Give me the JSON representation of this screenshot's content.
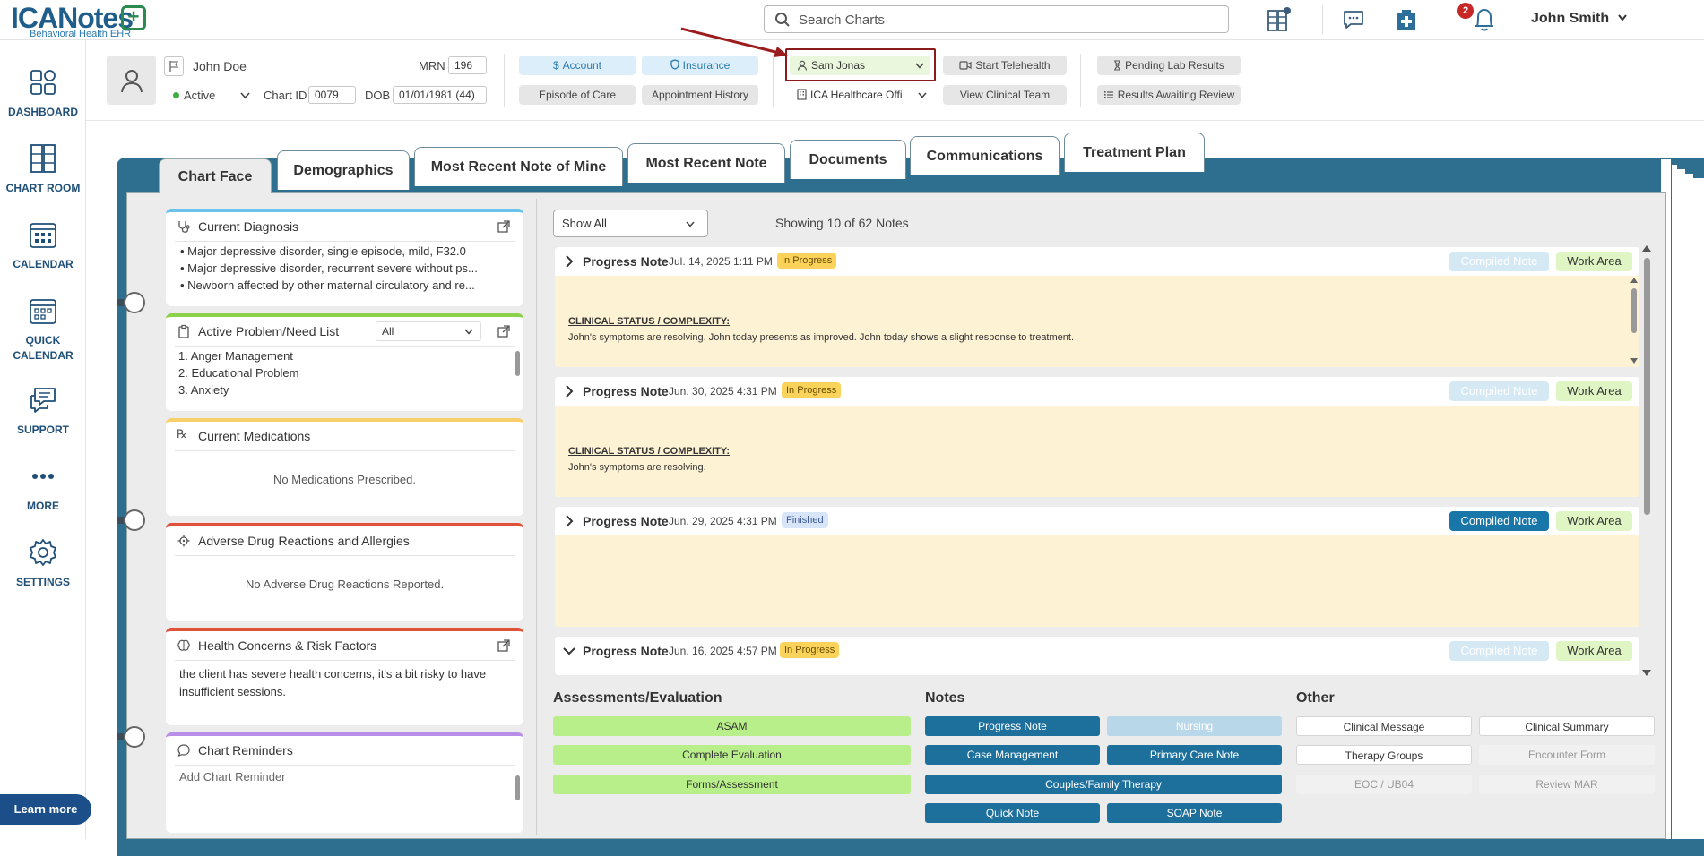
{
  "app": {
    "logo_main": "ICANotes",
    "logo_plus": "+",
    "logo_sub": "Behavioral Health EHR"
  },
  "topbar": {
    "search_placeholder": "Search Charts",
    "notification_count": "2",
    "user_name": "John Smith"
  },
  "sidebar": {
    "items": [
      {
        "label": "DASHBOARD",
        "icon": "dashboard-icon"
      },
      {
        "label": "CHART ROOM",
        "icon": "chart-room-icon"
      },
      {
        "label": "CALENDAR",
        "icon": "calendar-icon"
      },
      {
        "label": "QUICK",
        "label2": "CALENDAR",
        "icon": "quick-calendar-icon"
      },
      {
        "label": "SUPPORT",
        "icon": "support-icon"
      },
      {
        "label": "MORE",
        "icon": "more-icon"
      },
      {
        "label": "SETTINGS",
        "icon": "gear-icon"
      }
    ],
    "learn_more": "Learn more"
  },
  "patient": {
    "name": "John Doe",
    "status": "Active",
    "mrn_label": "MRN",
    "mrn": "196",
    "chart_id_label": "Chart ID",
    "chart_id": "0079",
    "dob_label": "DOB",
    "dob": "01/01/1981 (44)"
  },
  "header_buttons": {
    "account": "Account",
    "insurance": "Insurance",
    "episode_of_care": "Episode of Care",
    "appointment_history": "Appointment History",
    "provider": "Sam Jonas",
    "location": "ICA Healthcare Offi",
    "start_telehealth": "Start Telehealth",
    "view_clinical_team": "View Clinical Team",
    "pending_lab_results": "Pending Lab Results",
    "results_awaiting_review": "Results Awaiting Review"
  },
  "tabs": [
    "Chart Face",
    "Demographics",
    "Most Recent Note of Mine",
    "Most Recent Note",
    "Documents",
    "Communications",
    "Treatment Plan"
  ],
  "panels": {
    "diagnosis": {
      "title": "Current Diagnosis",
      "items": [
        "Major depressive disorder, single episode, mild, F32.0",
        "Major depressive disorder, recurrent severe without ps...",
        "Newborn affected by other maternal circulatory and re..."
      ]
    },
    "problems": {
      "title": "Active Problem/Need List",
      "filter": "All",
      "items": [
        "1. Anger Management",
        "2. Educational Problem",
        "3. Anxiety"
      ]
    },
    "medications": {
      "title": "Current Medications",
      "empty": "No Medications Prescribed."
    },
    "adverse": {
      "title": "Adverse Drug Reactions and Allergies",
      "empty": "No Adverse Drug Reactions Reported."
    },
    "health": {
      "title": "Health Concerns & Risk Factors",
      "text1": "the client has severe health concerns, it's a bit risky to have",
      "text2": "insufficient sessions."
    },
    "reminders": {
      "title": "Chart Reminders",
      "placeholder": "Add Chart Reminder"
    }
  },
  "notes": {
    "filter": "Show All",
    "showing": "Showing 10 of 62 Notes",
    "compiled_label": "Compiled Note",
    "work_area_label": "Work Area",
    "cards": [
      {
        "title": "Progress Note",
        "date": "Jul. 14, 2025 1:11 PM",
        "status": "In Progress",
        "heading": "CLINICAL STATUS / COMPLEXITY:",
        "text": "John's symptoms are resolving. John today presents as improved. John today shows a slight response to treatment."
      },
      {
        "title": "Progress Note",
        "date": "Jun. 30, 2025 4:31 PM",
        "status": "In Progress",
        "heading": "CLINICAL STATUS / COMPLEXITY:",
        "text": "John's symptoms are resolving."
      },
      {
        "title": "Progress Note",
        "date": "Jun. 29, 2025 4:31 PM",
        "status": "Finished"
      },
      {
        "title": "Progress Note",
        "date": "Jun. 16, 2025 4:57 PM",
        "status": "In Progress"
      }
    ]
  },
  "actions": {
    "assessments_title": "Assessments/Evaluation",
    "assessments": [
      "ASAM",
      "Complete Evaluation",
      "Forms/Assessment"
    ],
    "notes_title": "Notes",
    "notes": [
      "Progress Note",
      "Nursing",
      "Case Management",
      "Primary Care Note",
      "Couples/Family Therapy",
      "Quick Note",
      "SOAP Note"
    ],
    "other_title": "Other",
    "other": [
      "Clinical Message",
      "Clinical Summary",
      "Therapy Groups",
      "Encounter Form",
      "EOC / UB04",
      "Review MAR"
    ]
  },
  "colors": {
    "brand": "#1f5d8a",
    "highlight_border": "#8b1a1a",
    "annotation_arrow": "#9b1c1c"
  }
}
